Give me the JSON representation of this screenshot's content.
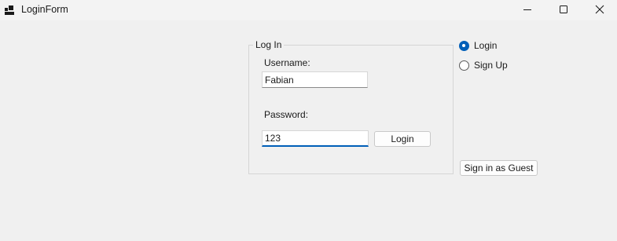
{
  "window": {
    "title": "LoginForm",
    "icon": "window-app-icon",
    "controls": [
      "minimize-icon",
      "maximize-icon",
      "close-icon"
    ]
  },
  "group": {
    "legend": "Log In"
  },
  "form": {
    "username_label": "Username:",
    "username_value": "Fabian",
    "password_label": "Password:",
    "password_value": "123",
    "login_button": "Login"
  },
  "mode": {
    "options": [
      {
        "label": "Login",
        "selected": true
      },
      {
        "label": "Sign Up",
        "selected": false
      }
    ]
  },
  "guest_button": "Sign in as Guest",
  "colors": {
    "accent": "#005fb8",
    "background": "#f0f0f0"
  }
}
